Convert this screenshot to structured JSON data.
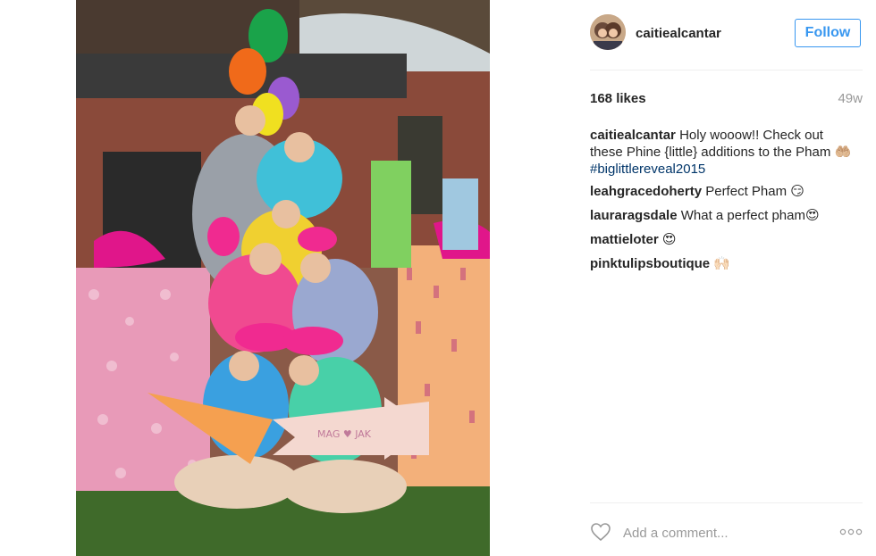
{
  "post": {
    "username": "caitiealcantar",
    "follow_label": "Follow",
    "likes": "168 likes",
    "age": "49w",
    "caption": {
      "username": "caitiealcantar",
      "text": "Holy wooow!! Check out these Phine {little} additions to the Pham",
      "emoji": "🤲🏼",
      "hashtag": "#biglittlereveal2015"
    },
    "comments": [
      {
        "username": "leahgracedoherty",
        "text": "Perfect Pham",
        "emoji": "😏"
      },
      {
        "username": "lauraragsdale",
        "text": "What a perfect pham",
        "emoji": "😍"
      },
      {
        "username": "mattieloter",
        "text": "",
        "emoji": "😍"
      },
      {
        "username": "pinktulipsboutique",
        "text": "",
        "emoji": "🙌🏻"
      }
    ],
    "comment_placeholder": "Add a comment...",
    "photo_sign_text": "MAG ♥ JAK"
  },
  "icons": {
    "heart": "heart-outline-icon",
    "more": "more-options-icon"
  },
  "colors": {
    "follow_blue": "#3897f0",
    "hashtag": "#003569",
    "muted": "#999999"
  }
}
